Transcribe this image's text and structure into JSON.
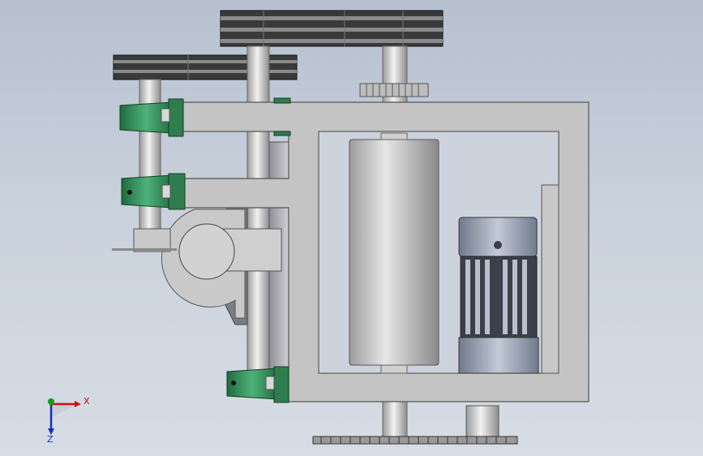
{
  "colors": {
    "background_top": "#b6c0cf",
    "background_bottom": "#d7dde5",
    "frame": "#c2c2c2",
    "shaft": "#d6d6d6",
    "bearing_green": "#3a8f5c",
    "motor_body": "#9aa4b5",
    "belt_dark": "#2e2e2e",
    "axis_x": "#d01010",
    "axis_y": "#10a010",
    "axis_z": "#1030c0"
  },
  "triad": {
    "x_label": "X",
    "z_label": "Z"
  }
}
